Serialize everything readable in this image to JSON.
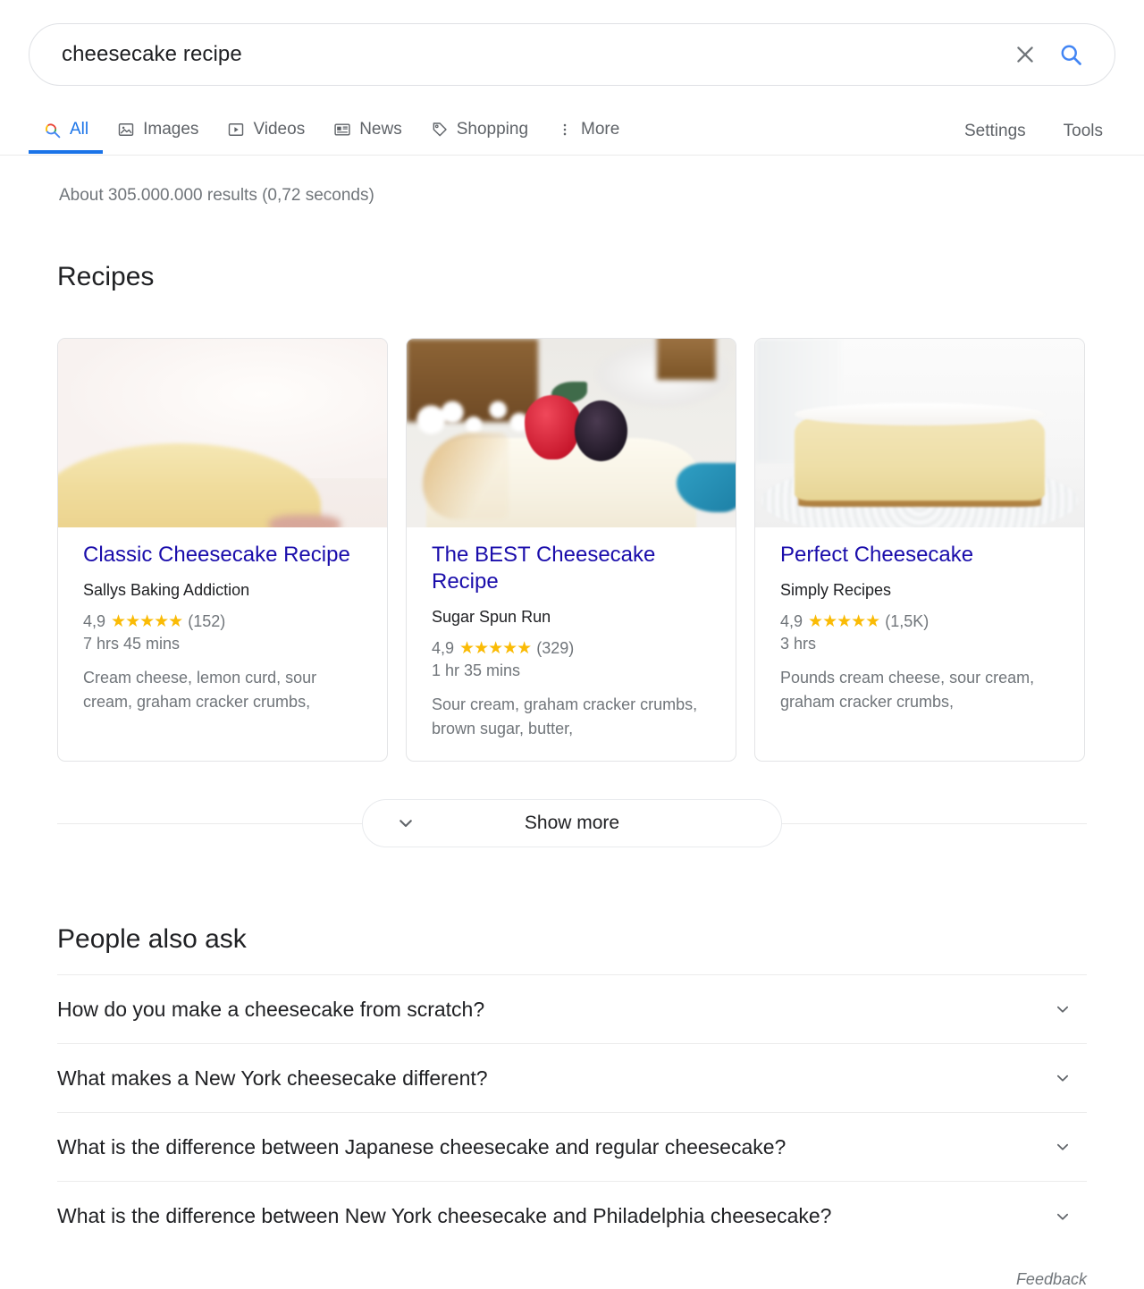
{
  "search": {
    "query": "cheesecake recipe",
    "placeholder": "Search",
    "clear_icon": "close-icon",
    "search_icon": "search-icon"
  },
  "nav": {
    "tabs": [
      {
        "label": "All",
        "icon": "google-search-icon",
        "active": true
      },
      {
        "label": "Images",
        "icon": "image-icon",
        "active": false
      },
      {
        "label": "Videos",
        "icon": "video-icon",
        "active": false
      },
      {
        "label": "News",
        "icon": "news-icon",
        "active": false
      },
      {
        "label": "Shopping",
        "icon": "tag-icon",
        "active": false
      },
      {
        "label": "More",
        "icon": "more-vertical-icon",
        "active": false
      }
    ],
    "settings_label": "Settings",
    "tools_label": "Tools",
    "active_accent": "#1a73e8"
  },
  "stats": "About 305.000.000 results (0,72 seconds)",
  "recipes": {
    "heading": "Recipes",
    "cards": [
      {
        "title": "Classic Cheesecake Recipe",
        "source": "Sallys Baking Addiction",
        "rating": "4,9",
        "stars": "★★★★★",
        "reviews": "(152)",
        "time": "7 hrs 45 mins",
        "ingredients": "Cream cheese, lemon curd, sour cream, graham cracker crumbs,",
        "image_alt": "classic-cheesecake-photo"
      },
      {
        "title": "The BEST Cheesecake Recipe",
        "source": "Sugar Spun Run",
        "rating": "4,9",
        "stars": "★★★★★",
        "reviews": "(329)",
        "time": "1 hr 35 mins",
        "ingredients": "Sour cream, graham cracker crumbs, brown sugar, butter,",
        "image_alt": "cheesecake-slice-with-berries-photo"
      },
      {
        "title": "Perfect Cheesecake",
        "source": "Simply Recipes",
        "rating": "4,9",
        "stars": "★★★★★",
        "reviews": "(1,5K)",
        "time": "3 hrs",
        "ingredients": "Pounds cream cheese, sour cream, graham cracker crumbs,",
        "image_alt": "whole-cheesecake-on-plate-photo"
      }
    ],
    "show_more_label": "Show more",
    "show_more_icon": "chevron-down-icon",
    "star_color": "#fabb05",
    "link_color": "#1a0dab"
  },
  "people_also_ask": {
    "heading": "People also ask",
    "questions": [
      {
        "text": "How do you make a cheesecake from scratch?",
        "icon": "chevron-down-icon"
      },
      {
        "text": "What makes a New York cheesecake different?",
        "icon": "chevron-down-icon"
      },
      {
        "text": "What is the difference between Japanese cheesecake and regular cheesecake?",
        "icon": "chevron-down-icon"
      },
      {
        "text": "What is the difference between New York cheesecake and Philadelphia cheesecake?",
        "icon": "chevron-down-icon"
      }
    ],
    "feedback_label": "Feedback"
  }
}
